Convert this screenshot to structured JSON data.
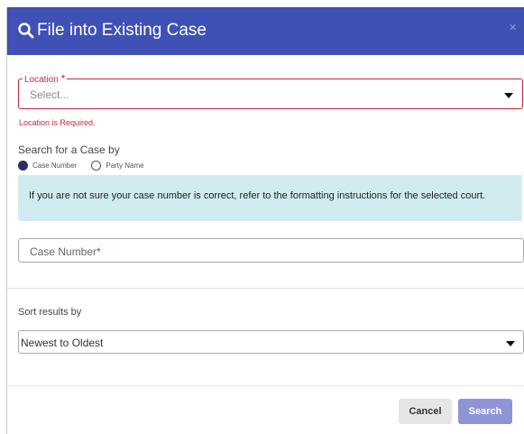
{
  "header": {
    "title": "File into Existing Case",
    "close_glyph": "×",
    "search_icon": "search-icon",
    "bg_color": "#3f51b5"
  },
  "location": {
    "label": "Location",
    "required_mark": "*",
    "value": "Select...",
    "error": "Location is Required."
  },
  "search_by": {
    "label": "Search for a Case by",
    "options": [
      {
        "label": "Case Number",
        "selected": true
      },
      {
        "label": "Party Name",
        "selected": false
      }
    ]
  },
  "info": {
    "text": "If you are not sure your case number is correct, refer to the formatting instructions for the selected court."
  },
  "case_number": {
    "placeholder": "Case Number",
    "required_mark": "*"
  },
  "sort": {
    "label": "Sort results by",
    "value": "Newest to Oldest"
  },
  "buttons": {
    "cancel": "Cancel",
    "search": "Search"
  },
  "colors": {
    "error": "#c8283a",
    "info_bg": "#d1ecf1",
    "search_button": "#8e95d6"
  }
}
